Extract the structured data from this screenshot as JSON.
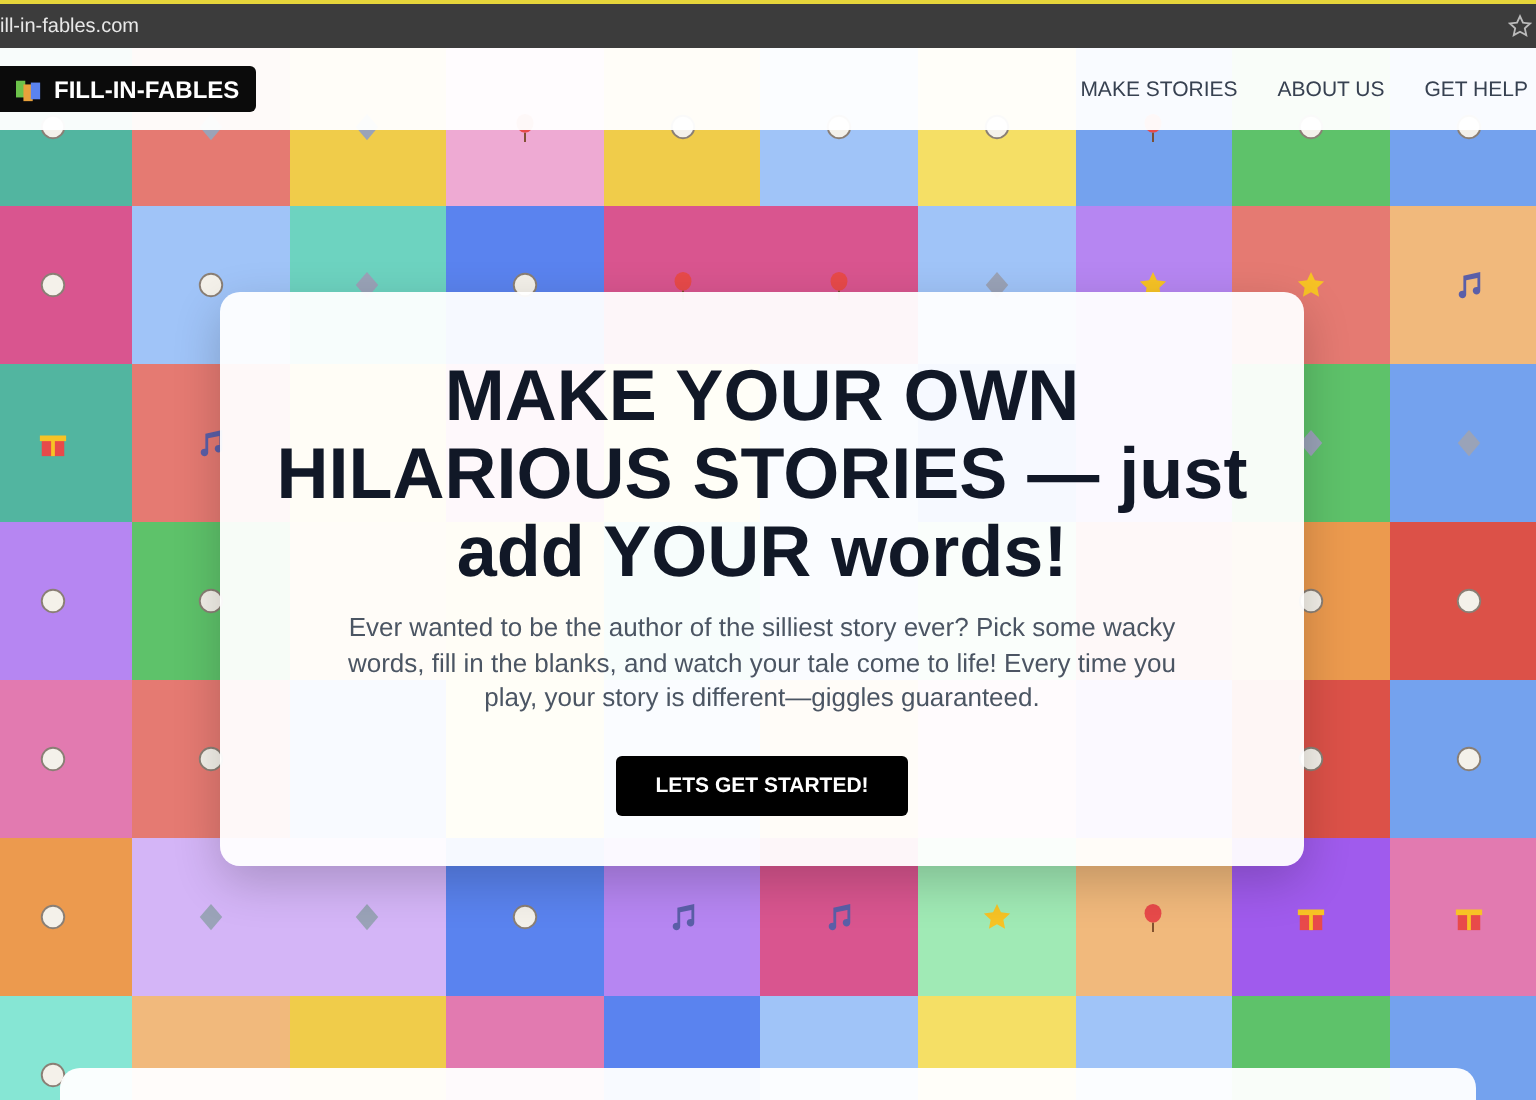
{
  "browser": {
    "url": "ill-in-fables.com"
  },
  "header": {
    "logo": "FILL-IN-FABLES",
    "nav": [
      {
        "label": "MAKE STORIES"
      },
      {
        "label": "ABOUT US"
      },
      {
        "label": "GET HELP"
      }
    ]
  },
  "hero": {
    "heading": "MAKE YOUR OWN HILARIOUS STORIES — just add YOUR words!",
    "text": "Ever wanted to be the author of the silliest story ever? Pick some wacky words, fill in the blanks, and watch your tale come to life! Every time you play, your story is different—giggles guaranteed.",
    "button": "LETS GET STARTED!"
  }
}
